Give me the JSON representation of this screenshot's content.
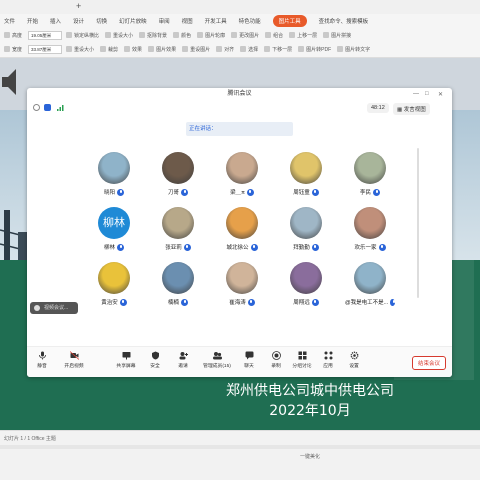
{
  "ribbon": {
    "menu": [
      "文件",
      "开始",
      "插入",
      "设计",
      "切换",
      "幻灯片放映",
      "审阅",
      "视图",
      "开发工具",
      "特色功能",
      "图片工具",
      "查找命令、搜索模板"
    ],
    "active_menu_index": 10,
    "row1": [
      "高度",
      "19.05厘米",
      "锁定纵横比",
      "重设大小",
      "抠除背景",
      "颜色",
      "图片轮廓",
      "更改图片",
      "组合",
      "上移一层",
      "图片拼接"
    ],
    "row2": [
      "宽度",
      "33.87厘米",
      "重设大小",
      "裁剪",
      "效果",
      "图片效果",
      "重设图片",
      "对齐",
      "选择",
      "下移一层",
      "图片转PDF",
      "图片转文字"
    ]
  },
  "meeting": {
    "title": "腾讯会议",
    "timer": "48:12",
    "view_button": "发言视图",
    "speaking": "正在讲话：",
    "participants": [
      {
        "name": "晓阳",
        "kind": "cartoon"
      },
      {
        "name": "刀哥",
        "kind": "photo"
      },
      {
        "name": "梁＿π",
        "kind": "photo"
      },
      {
        "name": "周钰童",
        "kind": "cartoon"
      },
      {
        "name": "李民",
        "kind": "photo"
      },
      {
        "name": "柳林",
        "kind": "text",
        "avatar_text": "柳林"
      },
      {
        "name": "张亚莉",
        "kind": "photo"
      },
      {
        "name": "城北徐公",
        "kind": "photo"
      },
      {
        "name": "拜勤勤",
        "kind": "cartoon"
      },
      {
        "name": "欢乐一家",
        "kind": "photo"
      },
      {
        "name": "黄治安",
        "kind": "photo"
      },
      {
        "name": "楠楠",
        "kind": "cartoon"
      },
      {
        "name": "崔海涛",
        "kind": "cartoon"
      },
      {
        "name": "周翔远",
        "kind": "photo"
      },
      {
        "name": "@我是电工不是...",
        "kind": "cartoon"
      }
    ],
    "tools": [
      "静音",
      "开启视频",
      "",
      "共享屏幕",
      "安全",
      "邀请",
      "管理成员(15)",
      "聊天",
      "录制",
      "分组讨论",
      "应用",
      "设置"
    ],
    "end_button": "结束会议",
    "toast": "视频会议..."
  },
  "slide": {
    "title": "郑州供电公司城中供电公司",
    "date": "2022年10月"
  },
  "statusbar": {
    "left": "幻灯片 1 / 1  Office 主题",
    "center": "一键美化"
  }
}
